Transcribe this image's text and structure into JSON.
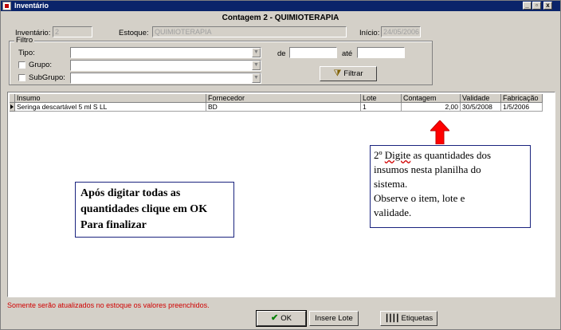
{
  "window": {
    "title": "Inventário",
    "controls": [
      "_",
      "▫",
      "x"
    ]
  },
  "form_title": "Contagem 2 - QUIMIOTERAPIA",
  "header": {
    "inventario_label": "Inventário:",
    "inventario_value": "2",
    "estoque_label": "Estoque:",
    "estoque_value": "QUIMIOTERAPIA",
    "inicio_label": "Início:",
    "inicio_value": "24/05/2006"
  },
  "filter": {
    "group_title": "Filtro",
    "tipo_label": "Tipo:",
    "grupo_label": "Grupo:",
    "subgrupo_label": "SubGrupo:",
    "de_label": "de",
    "ate_label": "até",
    "filtrar_label": "Filtrar"
  },
  "grid": {
    "columns": [
      "Insumo",
      "Fornecedor",
      "Lote",
      "Contagem",
      "Validade",
      "Fabricação"
    ],
    "rows": [
      [
        "Seringa  descartável 5 ml S LL",
        "BD",
        "1",
        "2,00",
        "30/5/2008",
        "1/5/2006"
      ]
    ]
  },
  "callouts": {
    "right": {
      "line1_prefix": "2º ",
      "line1_underlined": "Digite",
      "line1_rest": " as quantidades dos",
      "line2": "insumos nesta planilha do",
      "line3": "sistema.",
      "line4": "Observe o item, lote e",
      "line5": "validade."
    },
    "left": {
      "line1": "Após digitar todas as",
      "line2": "quantidades clique em OK",
      "line3": "Para finalizar"
    }
  },
  "status_text": "Somente serão atualizados no estoque os valores preenchidos.",
  "buttons": {
    "ok": "OK",
    "insere_lote": "Insere Lote",
    "etiquetas": "Etiquetas"
  },
  "colors": {
    "titlebar": "#0a246a",
    "status": "#d00000",
    "arrow": "#ff0000",
    "callout_border": "#1a237e"
  }
}
